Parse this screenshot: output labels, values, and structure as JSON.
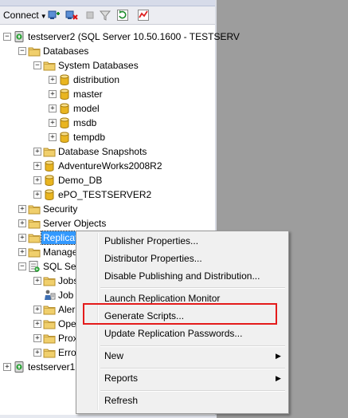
{
  "toolbar": {
    "connect_label": "Connect",
    "icons": [
      "connect-object-explorer-icon",
      "disconnect-icon",
      "stop-icon",
      "filter-icon",
      "refresh-icon",
      "activity-monitor-icon"
    ]
  },
  "tree": {
    "nodes": [
      {
        "label": "testserver2 (SQL Server 10.50.1600 - TESTSERV",
        "expander": "-",
        "icon": "server-icon"
      },
      {
        "label": "Databases",
        "expander": "-",
        "icon": "folder-icon"
      },
      {
        "label": "System Databases",
        "expander": "-",
        "icon": "folder-icon"
      },
      {
        "label": "distribution",
        "expander": "+",
        "icon": "database-icon"
      },
      {
        "label": "master",
        "expander": "+",
        "icon": "database-icon"
      },
      {
        "label": "model",
        "expander": "+",
        "icon": "database-icon"
      },
      {
        "label": "msdb",
        "expander": "+",
        "icon": "database-icon"
      },
      {
        "label": "tempdb",
        "expander": "+",
        "icon": "database-icon"
      },
      {
        "label": "Database Snapshots",
        "expander": "+",
        "icon": "folder-icon"
      },
      {
        "label": "AdventureWorks2008R2",
        "expander": "+",
        "icon": "database-icon"
      },
      {
        "label": "Demo_DB",
        "expander": "+",
        "icon": "database-icon"
      },
      {
        "label": "ePO_TESTSERVER2",
        "expander": "+",
        "icon": "database-icon"
      },
      {
        "label": "Security",
        "expander": "+",
        "icon": "folder-icon"
      },
      {
        "label": "Server Objects",
        "expander": "+",
        "icon": "folder-icon"
      },
      {
        "label": "Replicat",
        "expander": "+",
        "icon": "folder-icon"
      },
      {
        "label": "Manage",
        "expander": "+",
        "icon": "folder-icon"
      },
      {
        "label": "SQL Ser",
        "expander": "-",
        "icon": "sql-agent-icon"
      },
      {
        "label": "Jobs",
        "expander": "+",
        "icon": "folder-icon"
      },
      {
        "label": "Job",
        "expander": "",
        "icon": "job-activity-icon"
      },
      {
        "label": "Aler",
        "expander": "+",
        "icon": "folder-icon"
      },
      {
        "label": "Ope",
        "expander": "+",
        "icon": "folder-icon"
      },
      {
        "label": "Prox",
        "expander": "+",
        "icon": "folder-icon"
      },
      {
        "label": "Erro",
        "expander": "+",
        "icon": "folder-icon"
      },
      {
        "label": "testserver1",
        "expander": "+",
        "icon": "server-icon"
      }
    ]
  },
  "context_menu": {
    "items": [
      {
        "label": "Publisher Properties..."
      },
      {
        "label": "Distributor Properties..."
      },
      {
        "label": "Disable Publishing and Distribution..."
      },
      {
        "label": "Launch Replication Monitor"
      },
      {
        "label": "Generate Scripts..."
      },
      {
        "label": "Update Replication Passwords..."
      },
      {
        "label": "New",
        "submenu": true
      },
      {
        "label": "Reports",
        "submenu": true
      },
      {
        "label": "Refresh"
      }
    ]
  },
  "colors": {
    "selection": "#3399ff",
    "highlight_box": "#e41b1b",
    "right_panel": "#9d9d9d",
    "folder": "#e8c25a",
    "database": "#e9b520"
  }
}
